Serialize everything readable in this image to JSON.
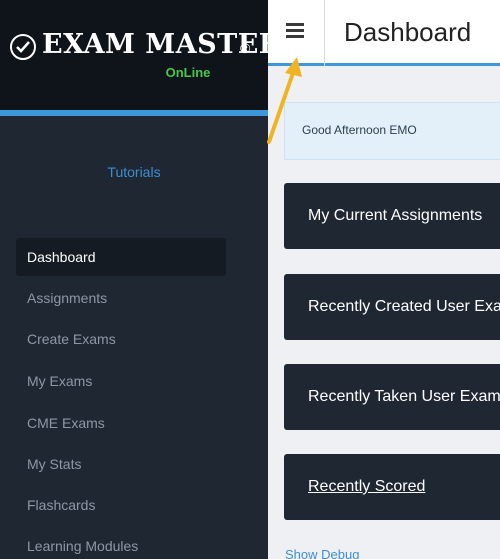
{
  "brand": {
    "name": "Exam Master",
    "registered": "®",
    "subtitle": "OnLine"
  },
  "sidebar": {
    "tutorials_link": "Tutorials",
    "items": [
      {
        "label": "Dashboard",
        "active": true
      },
      {
        "label": "Assignments"
      },
      {
        "label": "Create Exams"
      },
      {
        "label": "My Exams"
      },
      {
        "label": "CME Exams"
      },
      {
        "label": "My Stats"
      },
      {
        "label": "Flashcards"
      },
      {
        "label": "Learning Modules"
      }
    ]
  },
  "header": {
    "menu_icon": "hamburger-menu-icon",
    "title": "Dashboard"
  },
  "main": {
    "greeting": "Good Afternoon EMO",
    "panels": [
      {
        "title": "My Current Assignments"
      },
      {
        "title": "Recently Created User Exams"
      },
      {
        "title": "Recently Taken User Exams"
      },
      {
        "title": "Recently Scored"
      }
    ],
    "footer_link": "Show Debug"
  },
  "annotation": {
    "arrow_color": "#f0b323",
    "points_to": "hamburger-menu-icon"
  },
  "colors": {
    "sidebar_bg": "#1f2733",
    "logo_bg": "#0f141b",
    "accent_blue": "#3c98d9",
    "online_green": "#46c84a",
    "greeting_bg": "#e3f0f9"
  }
}
